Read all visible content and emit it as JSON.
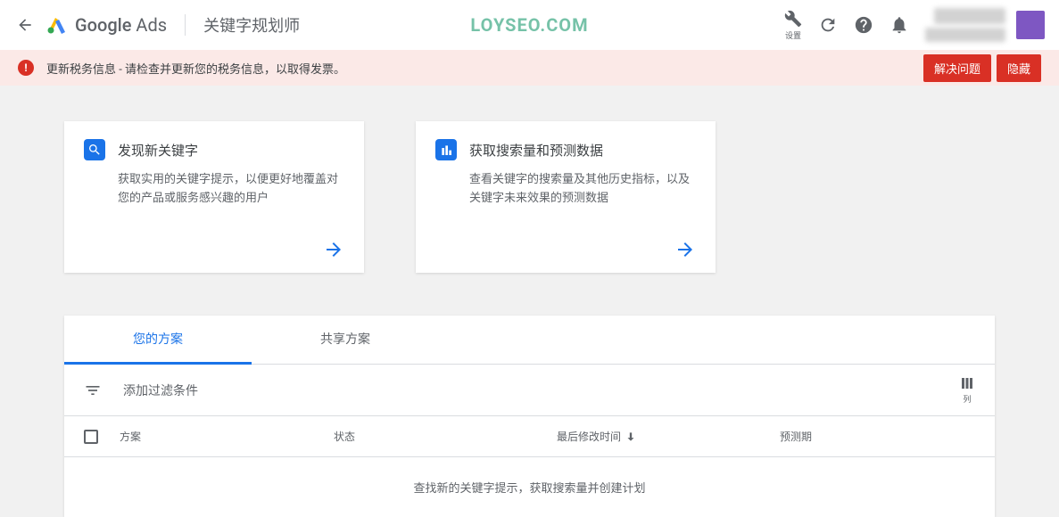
{
  "header": {
    "brand_prefix": "Google",
    "brand_suffix": " Ads",
    "page_title": "关键字规划师",
    "watermark": "LOYSEO.COM",
    "settings_label": "设置"
  },
  "alert": {
    "message": "更新税务信息 - 请检查并更新您的税务信息，以取得发票。",
    "resolve_btn": "解决问题",
    "hide_btn": "隐藏"
  },
  "cards": {
    "discover": {
      "title": "发现新关键字",
      "desc": "获取实用的关键字提示，以便更好地覆盖对您的产品或服务感兴趣的用户"
    },
    "volume": {
      "title": "获取搜索量和预测数据",
      "desc": "查看关键字的搜索量及其他历史指标，以及关键字未来效果的预测数据"
    }
  },
  "tabs": {
    "your_plans": "您的方案",
    "shared_plans": "共享方案"
  },
  "filter": {
    "add_filter": "添加过滤条件",
    "columns_label": "列"
  },
  "table": {
    "headers": {
      "plan": "方案",
      "status": "状态",
      "modified": "最后修改时间",
      "forecast": "预测期"
    },
    "empty_message": "查找新的关键字提示，获取搜索量并创建计划"
  }
}
